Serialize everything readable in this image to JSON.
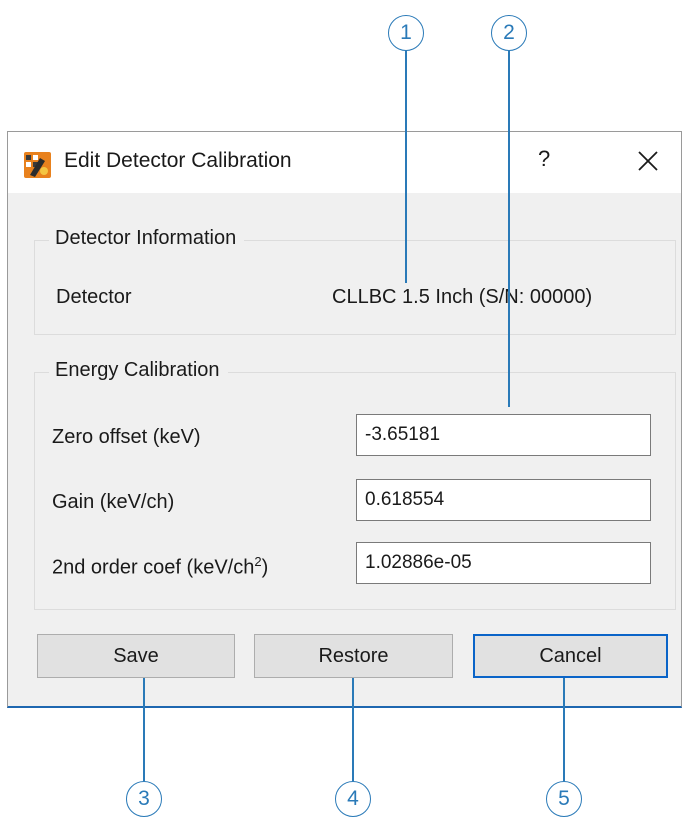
{
  "window": {
    "title": "Edit Detector Calibration",
    "help_label": "?",
    "icon": "app-logo-icon"
  },
  "detector_info": {
    "group_title": "Detector Information",
    "label": "Detector",
    "value": "CLLBC 1.5 Inch (S/N: 00000)"
  },
  "energy_calibration": {
    "group_title": "Energy Calibration",
    "zero_offset": {
      "label": "Zero offset (keV)",
      "value": "-3.65181"
    },
    "gain": {
      "label": "Gain (keV/ch)",
      "value": "0.618554"
    },
    "second_order": {
      "label_prefix": "2nd order coef (keV/ch",
      "label_sup": "2",
      "label_suffix": ")",
      "value": "1.02886e-05"
    }
  },
  "buttons": {
    "save": "Save",
    "restore": "Restore",
    "cancel": "Cancel"
  },
  "callouts": [
    "1",
    "2",
    "3",
    "4",
    "5"
  ],
  "colors": {
    "callout": "#2a7ab8",
    "dialog_bg": "#f0f0f0",
    "default_button_border": "#0a64c8"
  }
}
